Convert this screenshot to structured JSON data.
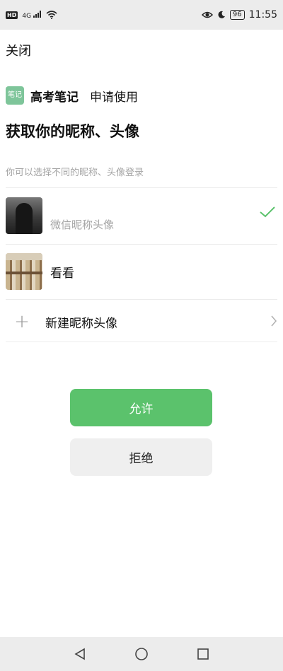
{
  "status_bar": {
    "hd_label": "HD",
    "signal_label": "4G",
    "battery": "96",
    "time": "11:55"
  },
  "close_label": "关闭",
  "app": {
    "logo_text": "笔记",
    "name": "高考笔记",
    "action": "申请使用"
  },
  "title": "获取你的昵称、头像",
  "subtitle": "你可以选择不同的昵称、头像登录",
  "options": [
    {
      "label": "微信昵称头像",
      "selected": true
    },
    {
      "label": "看看",
      "selected": false
    }
  ],
  "new_option_label": "新建昵称头像",
  "buttons": {
    "allow": "允许",
    "deny": "拒绝"
  },
  "colors": {
    "accent": "#5bc26c",
    "status_bar_bg": "#ececec",
    "deny_bg": "#efefef"
  }
}
